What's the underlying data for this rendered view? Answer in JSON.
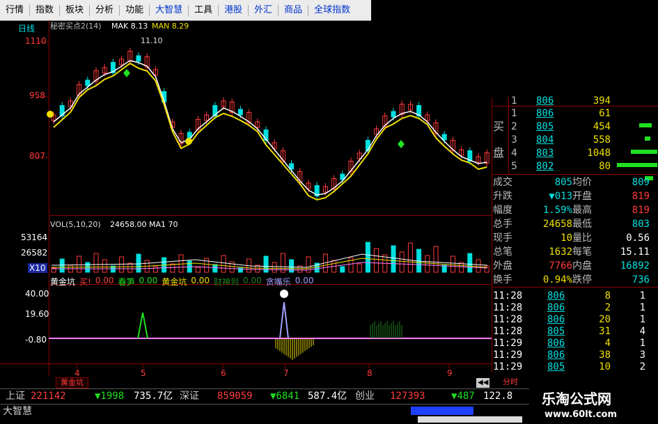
{
  "menubar": [
    "行情",
    "指数",
    "板块",
    "分析",
    "功能",
    "大智慧",
    "工具",
    "港股",
    "外汇",
    "商品",
    "全球指数"
  ],
  "menubar_blue": [
    5,
    7,
    8,
    9,
    10
  ],
  "chart": {
    "period_label": "日线",
    "indicator_title": "秘密买点2(14)",
    "mak_label": "MAK 8.13",
    "man_label": "MAN 8.29",
    "price_ticks": [
      "1110",
      "958",
      "807"
    ],
    "high_annotation": "11.10",
    "vol_title": "VOL(5,10,20)",
    "vol_value": "24658.00",
    "vol_ma_label": "MA1 70",
    "vol_ticks": [
      "53164",
      "26582"
    ],
    "vol_unit": "X10",
    "osc_legend": [
      {
        "name": "黄金坑",
        "color": "#ffffff"
      },
      {
        "name": "买!",
        "color": "#ff3b3b"
      },
      {
        "name": "0.00",
        "color": "#ff3b3b"
      },
      {
        "name": "春笋",
        "color": "#20e020"
      },
      {
        "name": "0.00",
        "color": "#20e020"
      },
      {
        "name": "黄金坑",
        "color": "#f0e000"
      },
      {
        "name": "0.00",
        "color": "#f0e000"
      },
      {
        "name": "财神到",
        "color": "#208020"
      },
      {
        "name": "0.00",
        "color": "#208020"
      },
      {
        "name": "贪嘴乐",
        "color": "#a0a0ff"
      },
      {
        "name": "0.00",
        "color": "#a0a0ff"
      }
    ],
    "osc_ticks": [
      "40.00",
      "19.60",
      "-0.80"
    ],
    "x_ticks": [
      "4",
      "5",
      "6",
      "7",
      "8",
      "9"
    ],
    "bottom_tab": "黄金坑",
    "bottom_tab2": "分时"
  },
  "order_book": [
    {
      "side_label": "",
      "level": "1",
      "price": "806",
      "vol": "394"
    },
    {
      "side_label": "",
      "level": "1",
      "price": "806",
      "vol": "61"
    },
    {
      "side_label": "买",
      "level": "2",
      "price": "805",
      "vol": "454"
    },
    {
      "side_label": "",
      "level": "3",
      "price": "804",
      "vol": "558"
    },
    {
      "side_label": "盘",
      "level": "4",
      "price": "803",
      "vol": "1048"
    },
    {
      "side_label": "",
      "level": "5",
      "price": "802",
      "vol": "80"
    }
  ],
  "quote": [
    {
      "l": "成交",
      "v": "805",
      "l2": "均价",
      "v2": "809",
      "c": "cyan",
      "c2": "cyan"
    },
    {
      "l": "升跌",
      "v": "▼013",
      "l2": "开盘",
      "v2": "819",
      "c": "cyan",
      "c2": "red"
    },
    {
      "l": "幅度",
      "v": "1.59%",
      "l2": "最高",
      "v2": "819",
      "c": "cyan",
      "c2": "red"
    },
    {
      "l": "总手",
      "v": "24658",
      "l2": "最低",
      "v2": "803",
      "c": "yellow",
      "c2": "cyan"
    },
    {
      "l": "现手",
      "v": "10",
      "l2": "量比",
      "v2": "0.56",
      "c": "yellow",
      "c2": "white"
    },
    {
      "l": "总笔",
      "v": "1632",
      "l2": "每笔",
      "v2": "15.11",
      "c": "yellow",
      "c2": "white"
    },
    {
      "l": "外盘",
      "v": "7766",
      "l2": "内盘",
      "v2": "16892",
      "c": "red",
      "c2": "cyan"
    },
    {
      "l": "换手",
      "v": "0.94%",
      "l2": "跌停",
      "v2": "736",
      "c": "yellow",
      "c2": "cyan"
    }
  ],
  "ticks": [
    {
      "t": "11:28",
      "p": "806",
      "v": "8",
      "n": "1"
    },
    {
      "t": "11:28",
      "p": "806",
      "v": "2",
      "n": "1"
    },
    {
      "t": "11:28",
      "p": "806",
      "v": "20",
      "n": "1"
    },
    {
      "t": "11:28",
      "p": "805",
      "v": "31",
      "n": "4"
    },
    {
      "t": "11:29",
      "p": "806",
      "v": "4",
      "n": "1"
    },
    {
      "t": "11:29",
      "p": "806",
      "v": "38",
      "n": "3"
    },
    {
      "t": "11:29",
      "p": "805",
      "v": "10",
      "n": "2"
    }
  ],
  "bottombar": {
    "sh_label": "上证",
    "sh_val": "221142",
    "sh_chg": "▼1998",
    "sh_amt": "735.7亿",
    "sz_label": "深证",
    "sz_val": "859059",
    "sz_chg": "▼6841",
    "sz_amt": "587.4亿",
    "cy_label": "创业",
    "cy_val": "127393",
    "cy_chg": "▼487",
    "cy_amt": "122.8",
    "app_name": "大智慧"
  },
  "watermark": {
    "title": "乐淘公式网",
    "url": "www.60lt.com"
  },
  "colors": {
    "up": "#ff3b3b",
    "down": "#00e0e0",
    "ma_white": "#ffffff",
    "ma_yellow": "#f0e000",
    "grid": "#8b0000"
  }
}
